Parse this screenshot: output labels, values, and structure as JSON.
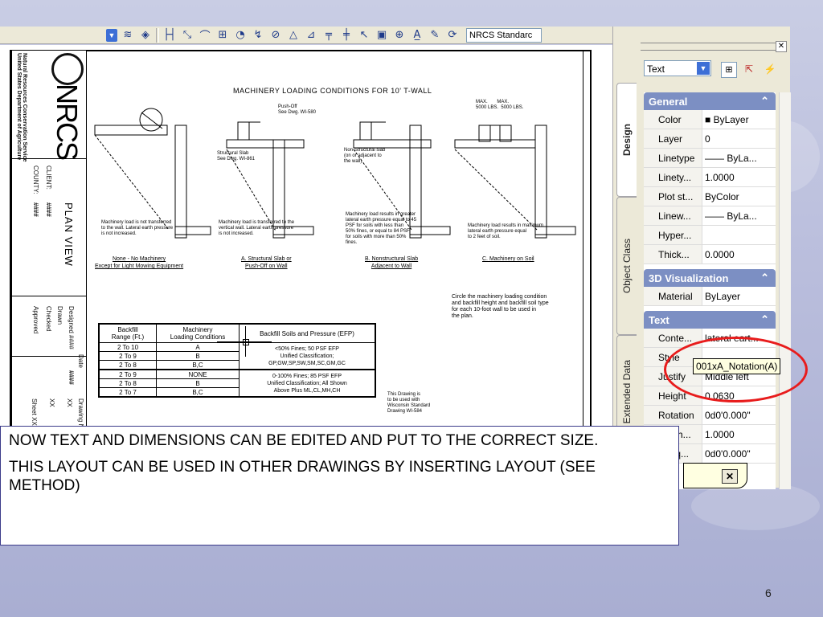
{
  "toolbar": {
    "icons": [
      "dropdown-arrow",
      "layer-tools-icon",
      "layer-prev-icon",
      "linear-dim-icon",
      "aligned-dim-icon",
      "arc-length-icon",
      "ordinate-dim-icon",
      "radius-dim-icon",
      "jogged-dim-icon",
      "diameter-dim-icon",
      "angular-dim-icon",
      "quick-dim-icon",
      "baseline-dim-icon",
      "continue-dim-icon",
      "leader-icon",
      "tolerance-icon",
      "center-mark-icon",
      "dim-edit-icon",
      "dim-text-edit-icon",
      "dim-update-icon"
    ],
    "dim_style": "NRCS Standarc"
  },
  "drawing": {
    "title": "MACHINERY LOADING CONDITIONS FOR 10' T-WALL",
    "org": "NRCS",
    "org_full": "Natural Resources Conservation Service\nUnited States Department of Agriculture",
    "client_label": "CLIENT:",
    "county_label": "COUNTY:",
    "hash": "####",
    "plan_view": "PLAN VIEW",
    "designed": "Designed ####",
    "drawn": "Drawn",
    "checked": "Checked",
    "approved": "Approved",
    "date_label": "Date",
    "date_value": "####",
    "drawing_label": "Drawing N",
    "sheet_label": "Sheet XX",
    "xx": "XX",
    "pushoff": "Push-Off\nSee Dwg. WI-580",
    "structural_slab": "Structural Slab\nSee Dwg. WI-861",
    "nonstructural": "Non-Structural slab\n(on or adjacent to\nthe wall)",
    "max": "MAX.       MAX.\n5000 LBS.  5000 LBS.",
    "desc1": "Machinery load is not transferred\nto the wall. Lateral earth pressure\nis not increased.",
    "desc2": "Machinery load is transferred to the\nvertical wall. Lateral earth pressure\nis not increased.",
    "desc3": "Machinery load results in greater\nlateral earth pressure equal to 45\nPSF for soils with less than\n50% fines, or equal to 84 PSF\nfor soils with more than 50%\nfines.",
    "desc4": "Machinery load results in maximum\nlateral earth pressure equal\nto 2 feet of soil.",
    "cap1": "None - No Machinery\nExcept for Light Mowing Equipment",
    "cap2": "A. Structural Slab or\nPush-Off on Wall",
    "cap3": "B. Nonstructural Slab\nAdjacent to Wall",
    "cap4": "C. Machinery on Soil",
    "instruction": "Circle the machinery loading condition\nand backfill height and backfill soil type\nfor each 10-foot wall to be used in\nthe plan.",
    "note": "This Drawing is\nto be used with\nWisconsin Standard\nDrawing WI-584",
    "table": {
      "headers": [
        "Backfill\nRange (Ft.)",
        "Machinery\nLoading Conditions",
        "Backfill Soils and Pressure (EFP)"
      ],
      "rows": [
        [
          "2 To 10",
          "A"
        ],
        [
          "2 To 9",
          "B"
        ],
        [
          "2 To 8",
          "B,C"
        ],
        [
          "2 To 9",
          "NONE"
        ],
        [
          "2 To 8",
          "B"
        ],
        [
          "2 To 7",
          "B,C"
        ]
      ],
      "group1": "<50% Fines; 50 PSF EFP\nUnified Classification;\nGP,GW,SP,SW,SM,SC,GM,GC",
      "group2": "0-100% Fines; 85 PSF EFP\nUnified Classification; All Shown\nAbove Plus ML,CL,MH,CH"
    }
  },
  "panel": {
    "selector": "Text",
    "tabs": [
      "Design",
      "Object Class",
      "Extended Data"
    ],
    "sections": [
      {
        "title": "General",
        "rows": [
          {
            "k": "Color",
            "v": "■ ByLayer"
          },
          {
            "k": "Layer",
            "v": "0"
          },
          {
            "k": "Linetype",
            "v": "—— ByLa..."
          },
          {
            "k": "Linety...",
            "v": "1.0000"
          },
          {
            "k": "Plot st...",
            "v": "ByColor"
          },
          {
            "k": "Linew...",
            "v": "—— ByLa..."
          },
          {
            "k": "Hyper...",
            "v": ""
          },
          {
            "k": "Thick...",
            "v": "0.0000"
          }
        ]
      },
      {
        "title": "3D Visualization",
        "rows": [
          {
            "k": "Material",
            "v": "ByLayer"
          }
        ]
      },
      {
        "title": "Text",
        "rows": [
          {
            "k": "Conte...",
            "v": "lateral eart..."
          },
          {
            "k": "Style",
            "v": ""
          },
          {
            "k": "Justify",
            "v": "Middle left"
          },
          {
            "k": "Height",
            "v": "0.0630"
          },
          {
            "k": "Rotation",
            "v": "0d0'0.000\""
          },
          {
            "k": "Width...",
            "v": "1.0000"
          },
          {
            "k": "Obliq...",
            "v": "0d0'0.000\""
          }
        ]
      }
    ],
    "tooltip": "001xA_Notation(A)"
  },
  "slide": {
    "line1": "NOW TEXT AND DIMENSIONS  CAN BE EDITED AND PUT TO THE CORRECT SIZE.",
    "line2": "THIS LAYOUT CAN BE USED IN OTHER DRAWINGS BY INSERTING LAYOUT (SEE METHOD)",
    "page": "6"
  },
  "colors": {
    "highlight_oval": "#e81c1c",
    "section_header": "#7c8fc3",
    "tooltip_bg": "#ffffe1"
  }
}
